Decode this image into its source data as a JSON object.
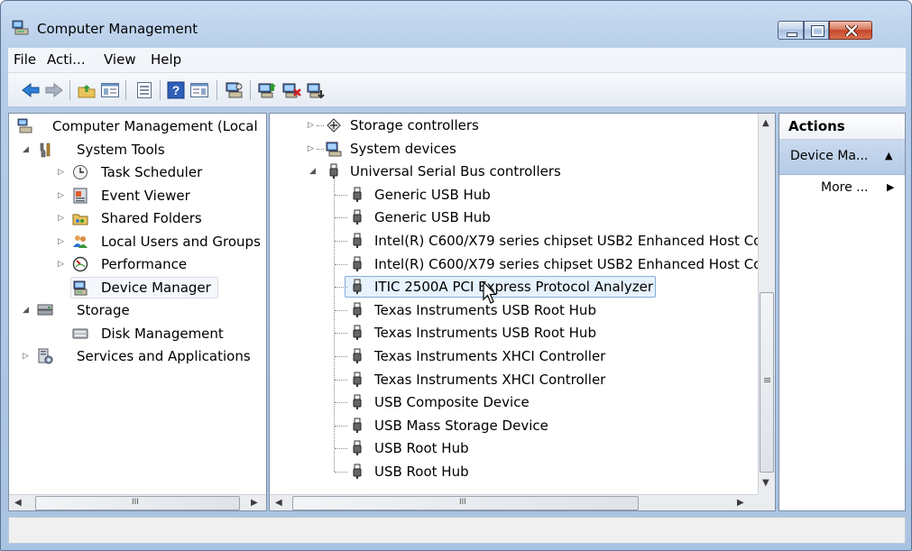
{
  "window": {
    "title": "Computer Management"
  },
  "menu": [
    "File",
    "Acti...",
    "View",
    "Help"
  ],
  "left_tree": [
    {
      "label": "Computer Management (Local",
      "level": 0
    },
    {
      "label": "System Tools",
      "level": 1
    },
    {
      "label": "Task Scheduler",
      "level": 2
    },
    {
      "label": "Event Viewer",
      "level": 2
    },
    {
      "label": "Shared Folders",
      "level": 2
    },
    {
      "label": "Local Users and Groups",
      "level": 2
    },
    {
      "label": "Performance",
      "level": 2
    },
    {
      "label": "Device Manager",
      "level": 2
    },
    {
      "label": "Storage",
      "level": 1
    },
    {
      "label": "Disk Management",
      "level": 2
    },
    {
      "label": "Services and Applications",
      "level": 1
    }
  ],
  "device_tree": {
    "categories": [
      "Storage controllers",
      "System devices",
      "Universal Serial Bus controllers"
    ],
    "devices": [
      "Generic USB Hub",
      "Generic USB Hub",
      "Intel(R) C600/X79 series chipset USB2 Enhanced Host Co",
      "Intel(R) C600/X79 series chipset USB2 Enhanced Host Co",
      "ITIC 2500A PCI Express Protocol Analyzer",
      "Texas Instruments USB Root Hub",
      "Texas Instruments USB Root Hub",
      "Texas Instruments XHCI Controller",
      "Texas Instruments XHCI Controller",
      "USB Composite Device",
      "USB Mass Storage Device",
      "USB Root Hub",
      "USB Root Hub"
    ]
  },
  "actions": {
    "header": "Actions",
    "section": "Device Ma...",
    "more": "More ..."
  },
  "scrollbar": {
    "grip": "III",
    "vgrip": "≡"
  },
  "colors": {
    "selection": "#e6f2fd",
    "selection_border": "#84acdd",
    "title_gradient": "#c9dcf2"
  }
}
